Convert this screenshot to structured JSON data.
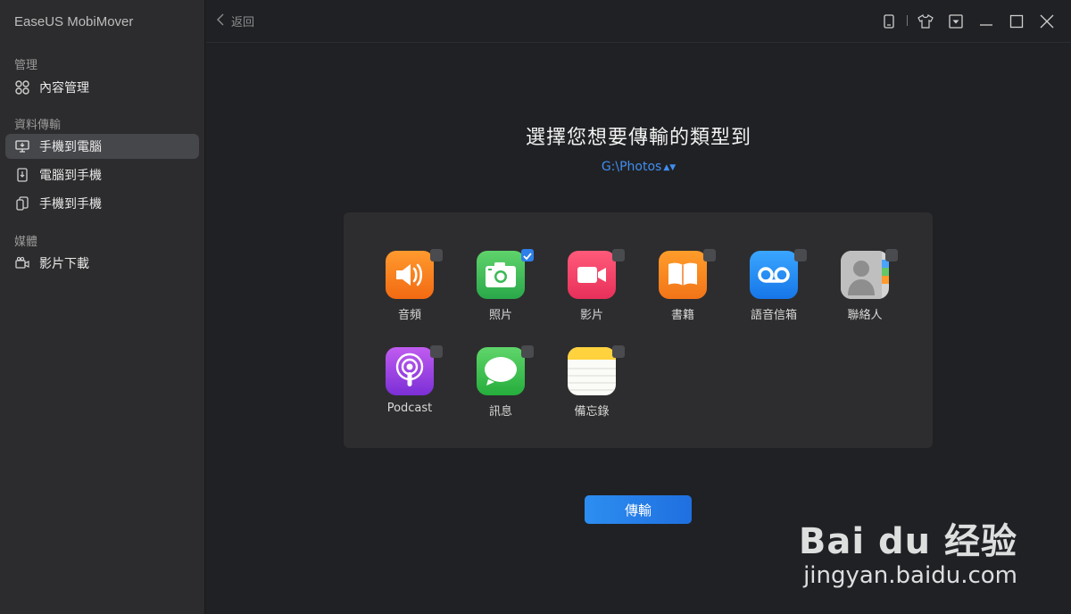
{
  "app": {
    "title": "EaseUS MobiMover"
  },
  "sidebar": {
    "sections": [
      {
        "label": "管理",
        "items": [
          {
            "label": "內容管理",
            "icon": "grid-circles-icon",
            "active": false
          }
        ]
      },
      {
        "label": "資料傳輸",
        "items": [
          {
            "label": "手機到電腦",
            "icon": "phone-to-pc-icon",
            "active": true
          },
          {
            "label": "電腦到手機",
            "icon": "pc-to-phone-icon",
            "active": false
          },
          {
            "label": "手機到手機",
            "icon": "phone-to-phone-icon",
            "active": false
          }
        ]
      },
      {
        "label": "媒體",
        "items": [
          {
            "label": "影片下載",
            "icon": "video-download-icon",
            "active": false
          }
        ]
      }
    ]
  },
  "topbar": {
    "back_label": "返回",
    "controls": [
      "device-icon",
      "tshirt-icon",
      "dropdown-menu-icon",
      "minimize-icon",
      "maximize-icon",
      "close-icon"
    ]
  },
  "main": {
    "heading": "選擇您想要傳輸的類型到",
    "destination": "G:\\Photos",
    "transfer_label": "傳輸"
  },
  "categories": [
    {
      "label": "音頻",
      "icon": "audio-icon",
      "checked": false
    },
    {
      "label": "照片",
      "icon": "photos-icon",
      "checked": true
    },
    {
      "label": "影片",
      "icon": "videos-icon",
      "checked": false
    },
    {
      "label": "書籍",
      "icon": "books-icon",
      "checked": false
    },
    {
      "label": "語音信箱",
      "icon": "voicemail-icon",
      "checked": false
    },
    {
      "label": "聯絡人",
      "icon": "contacts-icon",
      "checked": false
    },
    {
      "label": "Podcast",
      "icon": "podcast-icon",
      "checked": false
    },
    {
      "label": "訊息",
      "icon": "messages-icon",
      "checked": false
    },
    {
      "label": "備忘錄",
      "icon": "notes-icon",
      "checked": false
    }
  ],
  "watermark": {
    "brand": "Bai du 经验",
    "url": "jingyan.baidu.com"
  },
  "colors": {
    "accent": "#2f7fe8",
    "sidebar_bg": "#2c2c2e",
    "main_bg": "#202124",
    "panel_bg": "#2d2d2f"
  }
}
